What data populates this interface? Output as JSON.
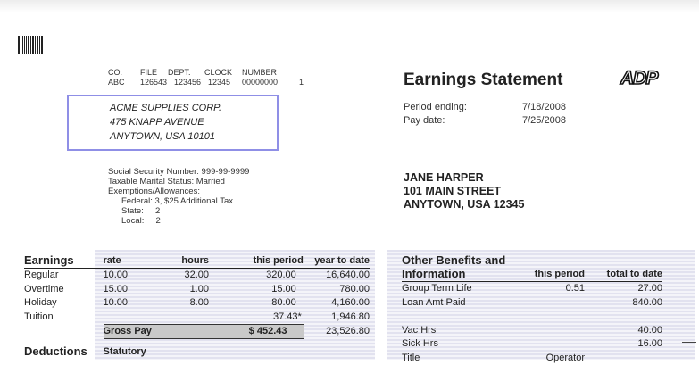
{
  "header": {
    "col_labels": [
      "CO.",
      "FILE",
      "DEPT.",
      "CLOCK",
      "NUMBER"
    ],
    "col_values": [
      "ABC",
      "126543",
      "123456",
      "12345",
      "00000000",
      "1"
    ]
  },
  "company": {
    "name": "ACME SUPPLIES CORP.",
    "address1": "475 KNAPP AVENUE",
    "address2": "ANYTOWN, USA 10101"
  },
  "statement": {
    "title": "Earnings Statement",
    "logo_text": "ADP",
    "period_ending_label": "Period ending:",
    "period_ending_value": "7/18/2008",
    "pay_date_label": "Pay date:",
    "pay_date_value": "7/25/2008"
  },
  "tax_info": {
    "ssn": "Social Security Number: 999-99-9999",
    "marital": "Taxable Marital Status: Married",
    "exemptions": "Exemptions/Allowances:",
    "federal": "Federal:  3, $25  Additional  Tax",
    "state": "State:     2",
    "local": "Local:     2"
  },
  "employee": {
    "name": "JANE HARPER",
    "street": "101 MAIN STREET",
    "city": "ANYTOWN, USA 12345"
  },
  "earnings": {
    "section": "Earnings",
    "headers": [
      "rate",
      "hours",
      "this period",
      "year to date"
    ],
    "rows": [
      {
        "label": "Regular",
        "rate": "10.00",
        "hours": "32.00",
        "period": "320.00",
        "ytd": "16,640.00"
      },
      {
        "label": "Overtime",
        "rate": "15.00",
        "hours": "1.00",
        "period": "15.00",
        "ytd": "780.00"
      },
      {
        "label": "Holiday",
        "rate": "10.00",
        "hours": "8.00",
        "period": "80.00",
        "ytd": "4,160.00"
      },
      {
        "label": "Tuition",
        "rate": "",
        "hours": "",
        "period": "37.43*",
        "ytd": "1,946.80"
      }
    ],
    "gross_label": "Gross Pay",
    "gross_period": "$  452.43",
    "gross_ytd": "23,526.80",
    "deductions_label": "Deductions",
    "statutory_label": "Statutory"
  },
  "benefits": {
    "section_line1": "Other Benefits and",
    "section_line2": "Information",
    "headers": [
      "this period",
      "total to date"
    ],
    "rows": [
      {
        "label": "Group Term Life",
        "period": "0.51",
        "total": "27.00"
      },
      {
        "label": "Loan Amt Paid",
        "period": "",
        "total": "840.00"
      },
      {
        "label": "",
        "period": "",
        "total": ""
      },
      {
        "label": "Vac  Hrs",
        "period": "",
        "total": "40.00"
      },
      {
        "label": "Sick Hrs",
        "period": "",
        "total": "16.00"
      },
      {
        "label": "Title",
        "period": "Operator",
        "total": ""
      }
    ]
  }
}
